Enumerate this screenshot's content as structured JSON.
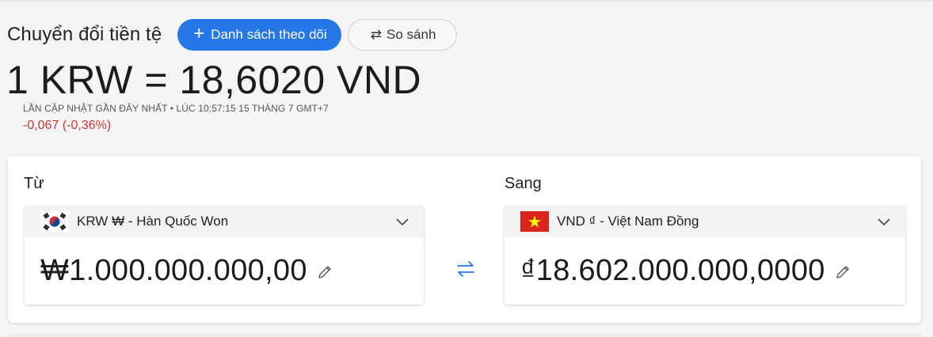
{
  "header": {
    "title": "Chuyển đổi tiền tệ",
    "watchlist_button": {
      "label": "Danh sách theo dõi",
      "icon": "plus-icon"
    },
    "compare_button": {
      "label": "So sánh",
      "icon": "swap-arrows-icon"
    }
  },
  "rate": {
    "text": "1 KRW = 18,6020 VND",
    "updated": "LẦN CẬP NHẬT GẦN ĐÂY NHẤT • LÚC 10:57:15 15 THÁNG 7 GMT+7",
    "change": "-0,067 (-0,36%)",
    "change_color": "#d13438"
  },
  "converter": {
    "from": {
      "label": "Từ",
      "currency": "KRW ₩ - Hàn Quốc Won",
      "amount": "₩1.000.000.000,00",
      "flag": "south-korea-flag-icon"
    },
    "to": {
      "label": "Sang",
      "currency": "VND ₫ - Việt Nam Đồng",
      "amount": "₫18.602.000.000,0000",
      "flag": "vietnam-flag-icon"
    },
    "swap_icon": "swap-arrows-icon"
  },
  "colors": {
    "accent": "#2577e8",
    "negative": "#d13438",
    "background": "#f5f5f5",
    "card": "#ffffff"
  }
}
